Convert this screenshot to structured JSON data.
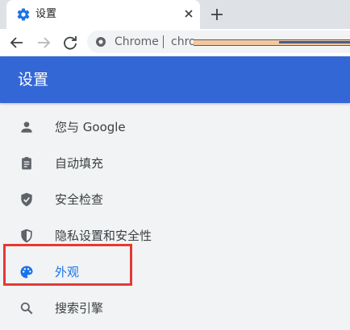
{
  "tab": {
    "title": "设置"
  },
  "toolbar": {
    "site_chip": "Chrome",
    "url_prefix": "chro"
  },
  "header": {
    "title": "设置"
  },
  "menu": {
    "items": [
      {
        "label": "您与 Google",
        "icon": "person-icon"
      },
      {
        "label": "自动填充",
        "icon": "clipboard-icon"
      },
      {
        "label": "安全检查",
        "icon": "shield-check-icon"
      },
      {
        "label": "隐私设置和安全性",
        "icon": "privacy-shield-icon"
      },
      {
        "label": "外观",
        "icon": "palette-icon"
      },
      {
        "label": "搜索引擎",
        "icon": "search-icon"
      }
    ],
    "selected_index": 4
  },
  "colors": {
    "accent": "#1a73e8",
    "header": "#3367d6",
    "highlight": "#e53935"
  }
}
